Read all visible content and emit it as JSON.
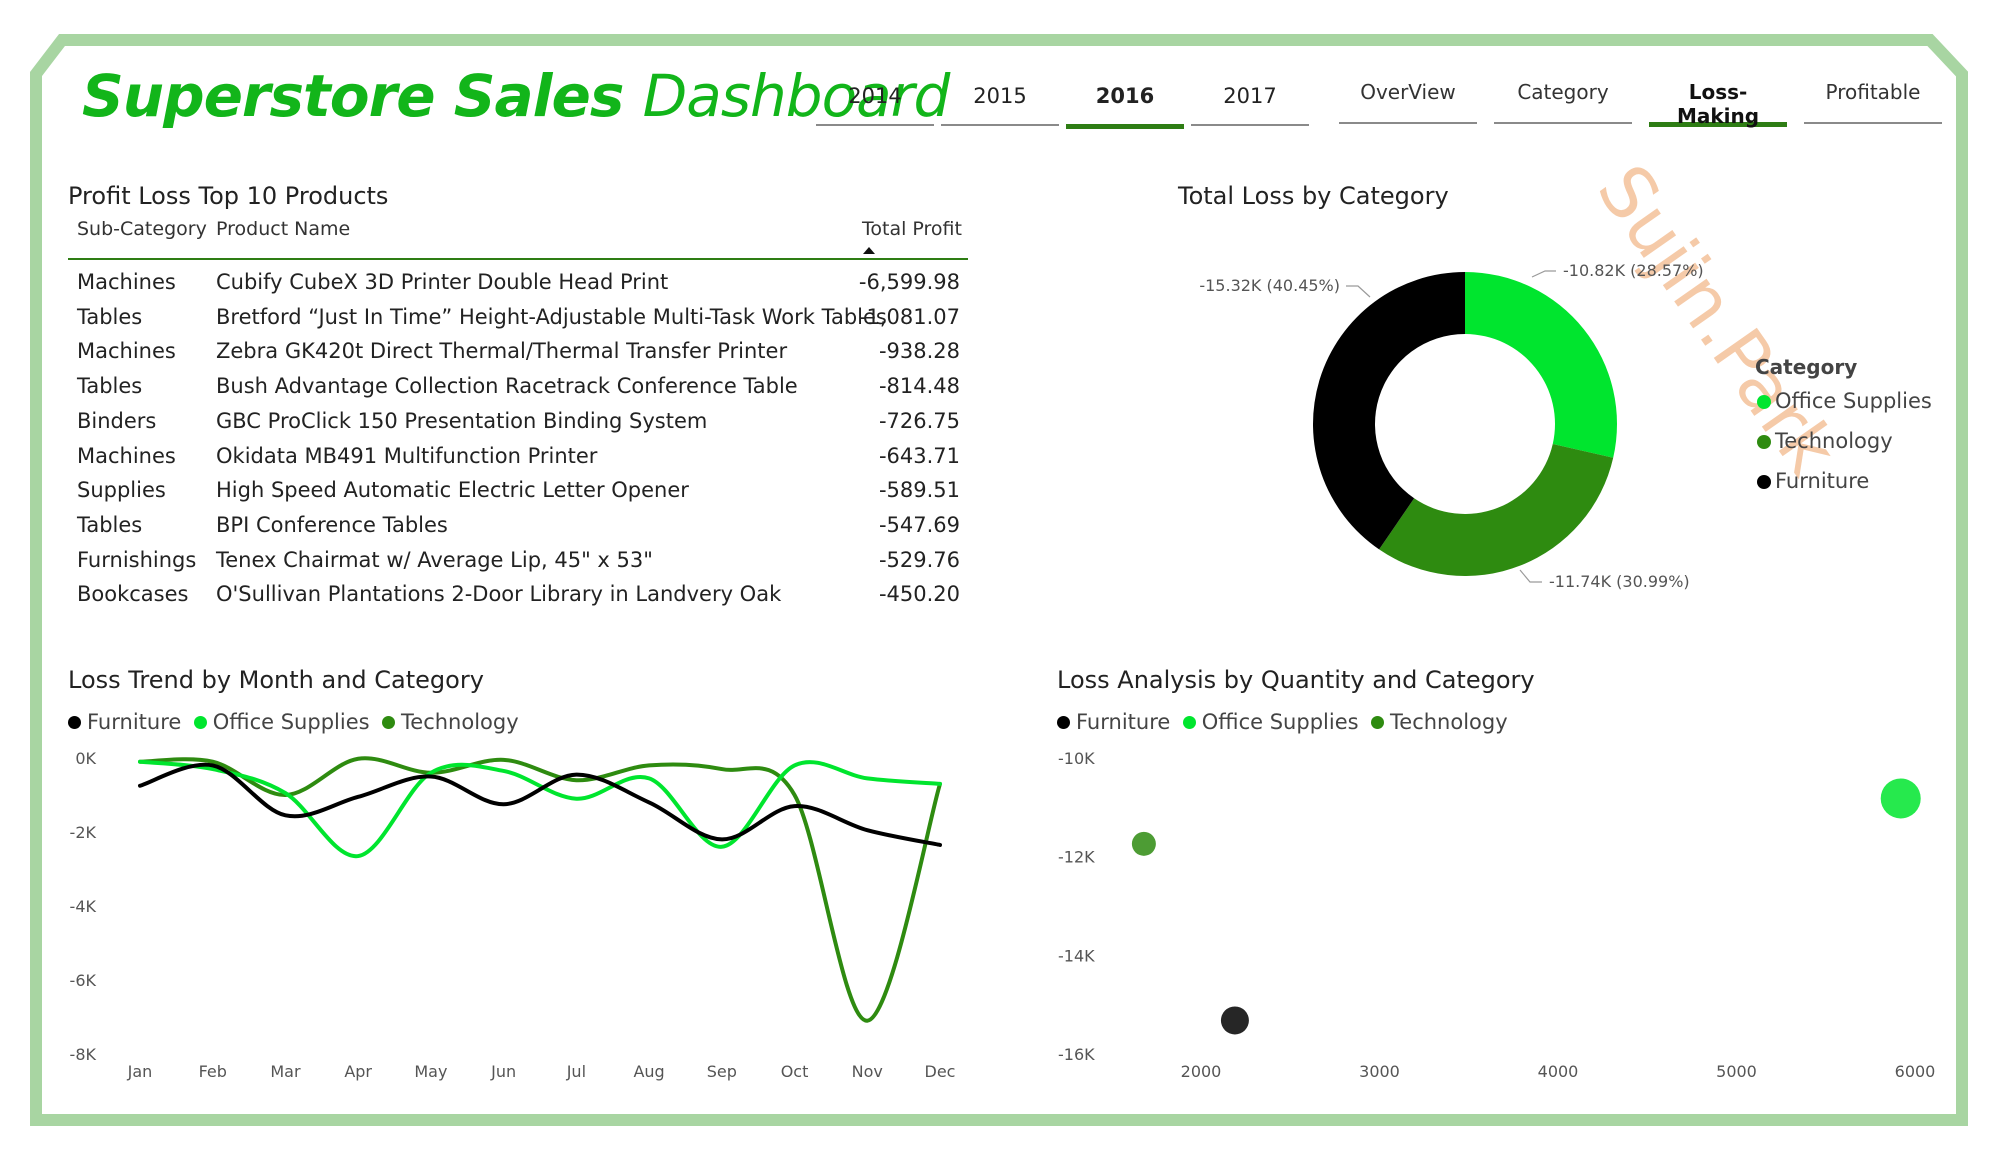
{
  "header": {
    "title_bold": "Superstore Sales",
    "title_light": "Dashboard",
    "years": [
      "2014",
      "2015",
      "2016",
      "2017"
    ],
    "active_year": "2016",
    "nav": [
      "OverView",
      "Category",
      "Loss-Making",
      "Profitable"
    ],
    "active_nav": "Loss-Making"
  },
  "watermark": "Sujin.Park",
  "colors": {
    "frame": "#a8d5a2",
    "title": "#12b51a",
    "accent": "#2e7d14",
    "furniture": "#000000",
    "office_supplies": "#00e52e",
    "technology": "#2e8b10"
  },
  "table": {
    "title": "Profit Loss Top 10 Products",
    "columns": [
      "Sub-Category",
      "Product Name",
      "Total Profit"
    ],
    "rows": [
      [
        "Machines",
        "Cubify CubeX 3D Printer Double Head Print",
        "-6,599.98"
      ],
      [
        "Tables",
        "Bretford “Just In Time” Height-Adjustable Multi-Task Work Tables",
        "-1,081.07"
      ],
      [
        "Machines",
        "Zebra GK420t Direct Thermal/Thermal Transfer Printer",
        "-938.28"
      ],
      [
        "Tables",
        "Bush Advantage Collection Racetrack Conference Table",
        "-814.48"
      ],
      [
        "Binders",
        "GBC ProClick 150 Presentation Binding System",
        "-726.75"
      ],
      [
        "Machines",
        "Okidata MB491 Multifunction Printer",
        "-643.71"
      ],
      [
        "Supplies",
        "High Speed Automatic Electric Letter Opener",
        "-589.51"
      ],
      [
        "Tables",
        "BPI Conference Tables",
        "-547.69"
      ],
      [
        "Furnishings",
        "Tenex Chairmat w/ Average Lip, 45\" x 53\"",
        "-529.76"
      ],
      [
        "Bookcases",
        "O'Sullivan Plantations 2-Door Library in Landvery Oak",
        "-450.20"
      ]
    ]
  },
  "legend_names": [
    "Furniture",
    "Office Supplies",
    "Technology"
  ],
  "chart_data": [
    {
      "type": "pie",
      "title": "Total Loss by Category",
      "legend_title": "Category",
      "legend_position": "right",
      "legend": [
        "Office Supplies",
        "Technology",
        "Furniture"
      ],
      "labels": [
        "Office Supplies",
        "Technology",
        "Furniture"
      ],
      "values": [
        -10.82,
        -11.74,
        -15.32
      ],
      "percents": [
        28.57,
        30.99,
        40.45
      ],
      "data_labels": [
        "-10.82K (28.57%)",
        "-11.74K (30.99%)",
        "-15.32K (40.45%)"
      ],
      "donut": true
    },
    {
      "type": "line",
      "title": "Loss Trend by Month and Category",
      "legend_position": "top-left",
      "x": [
        "Jan",
        "Feb",
        "Mar",
        "Apr",
        "May",
        "Jun",
        "Jul",
        "Aug",
        "Sep",
        "Oct",
        "Nov",
        "Dec"
      ],
      "yticks": [
        "0K",
        "-2K",
        "-4K",
        "-6K",
        "-8K"
      ],
      "ylim": [
        -8000,
        0
      ],
      "series": [
        {
          "name": "Furniture",
          "values": [
            -750,
            -200,
            -1550,
            -1050,
            -500,
            -1250,
            -450,
            -1200,
            -2200,
            -1300,
            -1950,
            -2350
          ]
        },
        {
          "name": "Office Supplies",
          "values": [
            -100,
            -300,
            -950,
            -2650,
            -400,
            -350,
            -1100,
            -550,
            -2400,
            -200,
            -550,
            -700
          ]
        },
        {
          "name": "Technology",
          "values": [
            -100,
            -100,
            -1000,
            -20,
            -400,
            -50,
            -600,
            -200,
            -300,
            -1000,
            -7100,
            -700
          ]
        }
      ]
    },
    {
      "type": "scatter",
      "title": "Loss Analysis by Quantity and Category",
      "legend_position": "top-left",
      "xticks": [
        "2000",
        "3000",
        "4000",
        "5000",
        "6000"
      ],
      "yticks": [
        "-10K",
        "-12K",
        "-14K",
        "-16K"
      ],
      "xlim": [
        1500,
        6000
      ],
      "ylim": [
        -16000,
        -10000
      ],
      "series": [
        {
          "name": "Technology",
          "x": [
            1680
          ],
          "y": [
            -11740
          ]
        },
        {
          "name": "Furniture",
          "x": [
            2190
          ],
          "y": [
            -15320
          ]
        },
        {
          "name": "Office Supplies",
          "x": [
            5920
          ],
          "y": [
            -10820
          ]
        }
      ]
    }
  ]
}
